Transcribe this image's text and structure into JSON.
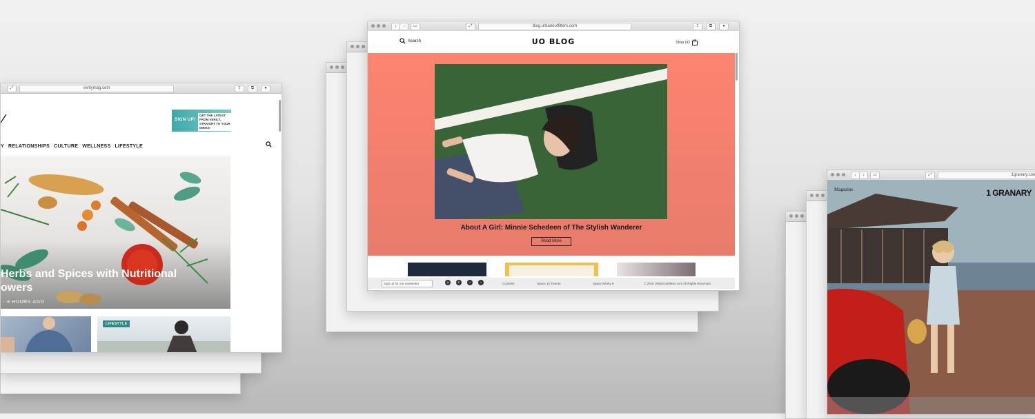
{
  "windows": {
    "verily": {
      "url": "verilymag.com",
      "banner": {
        "signup": "SIGN UP!",
        "tagline": "GET THE LATEST FROM VERILY, STRAIGHT TO YOUR INBOX!"
      },
      "nav": [
        "Y",
        "RELATIONSHIPS",
        "CULTURE",
        "WELLNESS",
        "LIFESTYLE"
      ],
      "hero": {
        "title_line1": "Herbs and Spices with Nutritional",
        "title_line2": "owers",
        "time": "· 6 HOURS AGO"
      },
      "badge": "LIFESTYLE"
    },
    "uo": {
      "url": "blog.urbanoutfitters.com",
      "search_label": "Search",
      "logo": "UO BLOG",
      "shop_label": "Shop UO",
      "hero": {
        "title": "About A Girl: Minnie Schedeen of The Stylish Wanderer",
        "button": "Read More",
        "bg": "#fd8470"
      },
      "footer": {
        "newsletter": "Sign up for our newsletter",
        "links": [
          "Contests",
          "Space 15 Twenty",
          "Space Ninety 8"
        ],
        "copyright": "© 2016 UrbanOutfitters.com All Rights Reserved"
      }
    },
    "granary": {
      "url": "1granary.com",
      "logo": "1 GRANARY",
      "section": "Magazine"
    }
  },
  "colors": {
    "uo_coral": "#fd8470",
    "verily_teal": "#3fa9a9"
  }
}
